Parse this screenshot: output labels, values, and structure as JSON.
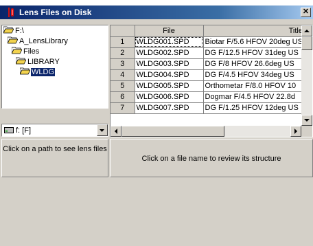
{
  "window": {
    "title": "Lens Files on Disk",
    "close_label": "✕"
  },
  "tree": {
    "items": [
      {
        "label": "F:\\",
        "icon": "open-folder-icon"
      },
      {
        "label": "A_LensLibrary",
        "icon": "open-folder-icon"
      },
      {
        "label": "Files",
        "icon": "open-folder-icon"
      },
      {
        "label": "LIBRARY",
        "icon": "open-folder-icon"
      },
      {
        "label": "WLDG",
        "icon": "open-folder-icon",
        "selected": true
      }
    ]
  },
  "drive": {
    "value": "f: [F]",
    "icon": "drive-icon"
  },
  "grid": {
    "columns": [
      "",
      "File",
      "Title"
    ],
    "rows": [
      {
        "num": "1",
        "file": "WLDG001.SPD",
        "title": "Biotar F/5.6 HFOV 20deg US"
      },
      {
        "num": "2",
        "file": "WLDG002.SPD",
        "title": "DG F/12.5 HFOV 31deg US"
      },
      {
        "num": "3",
        "file": "WLDG003.SPD",
        "title": "DG F/8 HFOV 26.6deg US"
      },
      {
        "num": "4",
        "file": "WLDG004.SPD",
        "title": "DG F/4.5 HFOV 34deg US"
      },
      {
        "num": "5",
        "file": "WLDG005.SPD",
        "title": "Orthometar F/8.0 HFOV 10"
      },
      {
        "num": "6",
        "file": "WLDG006.SPD",
        "title": "Dogmar F/4.5 HFOV 22.8d"
      },
      {
        "num": "7",
        "file": "WLDG007.SPD",
        "title": "DG F/1.25 HFOV 12deg US"
      }
    ]
  },
  "status": {
    "left": "Click on a path to see lens files",
    "right": "Click on a file name to review its structure"
  },
  "colors": {
    "titlebar": "#0a246a",
    "selection": "#0a246a",
    "face": "#d4d0c8"
  }
}
